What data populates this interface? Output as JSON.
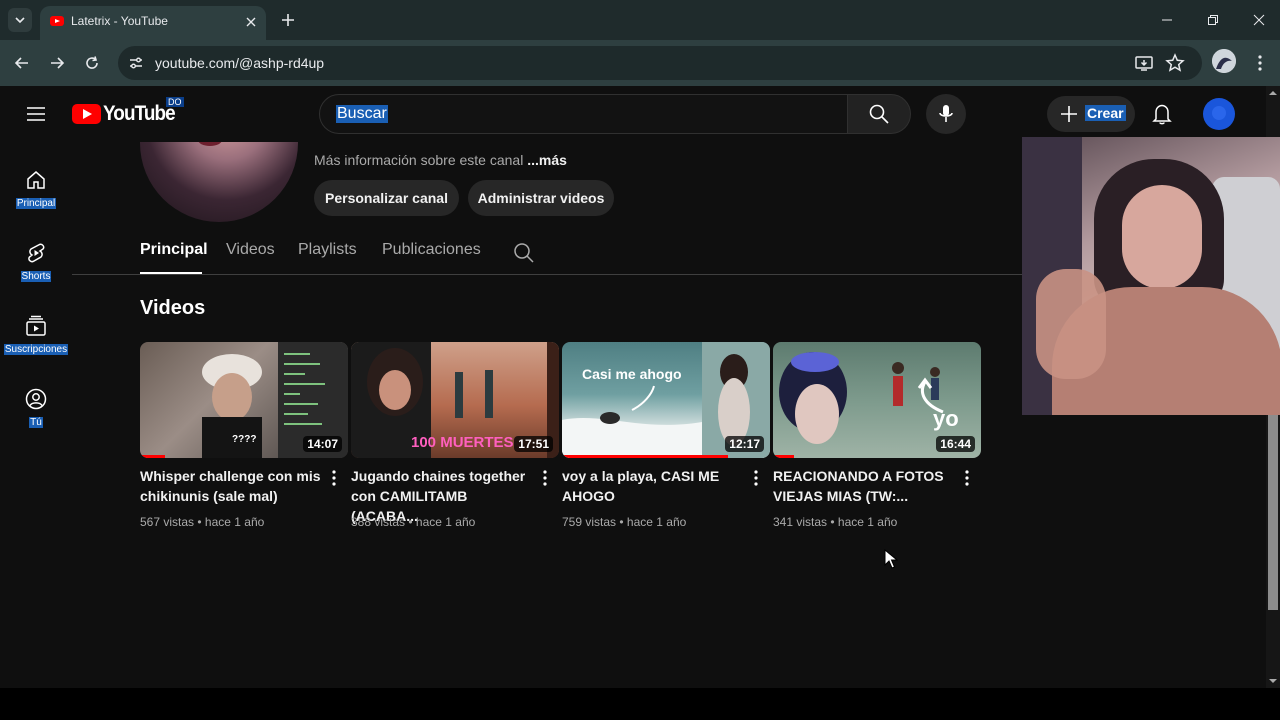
{
  "browser": {
    "tab_title": "Latetrix - YouTube",
    "url": "youtube.com/@ashp-rd4up"
  },
  "header": {
    "logo_text": "YouTube",
    "country_code": "DO",
    "search_placeholder": "Buscar",
    "create_label": "Crear"
  },
  "guide": {
    "items": [
      {
        "label": "Principal",
        "icon": "home-icon"
      },
      {
        "label": "Shorts",
        "icon": "shorts-icon"
      },
      {
        "label": "Suscripciones",
        "icon": "subscriptions-icon"
      },
      {
        "label": "Tú",
        "icon": "you-icon"
      }
    ]
  },
  "channel": {
    "more_info_prefix": "Más información sobre este canal ",
    "more_info_link": "...más",
    "customize_label": "Personalizar canal",
    "manage_label": "Administrar videos",
    "tabs": [
      "Principal",
      "Videos",
      "Playlists",
      "Publicaciones"
    ],
    "active_tab": "Principal"
  },
  "videos_section": {
    "title": "Videos",
    "videos": [
      {
        "title": "Whisper challenge con mis chikinunis (sale mal)",
        "duration": "14:07",
        "views": "567 vistas",
        "age": "hace 1 año",
        "thumb_text": "????",
        "watched": 0.12
      },
      {
        "title": "Jugando chaines together con CAMILITAMB (ACABA...",
        "duration": "17:51",
        "views": "388 vistas",
        "age": "hace 1 año",
        "thumb_text": "100 MUERTES",
        "watched": 0.0
      },
      {
        "title": "voy a la playa, CASI ME AHOGO",
        "duration": "12:17",
        "views": "759 vistas",
        "age": "hace 1 año",
        "thumb_text": "Casi me ahogo",
        "watched": 0.8
      },
      {
        "title": "REACIONANDO A FOTOS VIEJAS MIAS (TW:...",
        "duration": "16:44",
        "views": "341 vistas",
        "age": "hace 1 año",
        "thumb_text": "yo",
        "watched": 0.1
      }
    ]
  },
  "colors": {
    "accent_red": "#ff0000",
    "selection_blue": "#1a5fb4",
    "background": "#0f0f0f"
  }
}
